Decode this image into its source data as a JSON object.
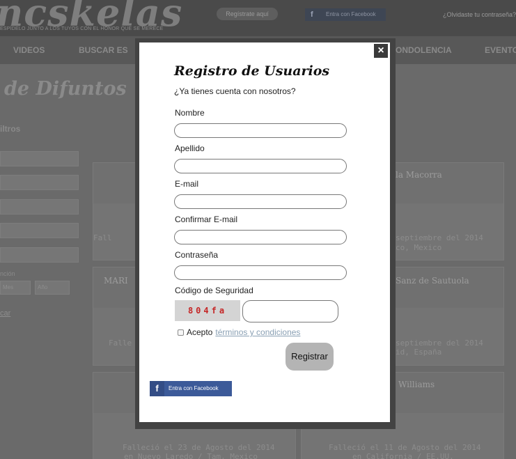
{
  "background": {
    "logo": "ncskelas",
    "tagline": "ESPÍDELO JUNTO A LOS TUYOS CON EL HONOR QUE SE MERECE",
    "register_link": "Regístrate aquí",
    "facebook_login": "Entra con Facebook",
    "forgot_password": "¿Olvidaste tu contraseña?",
    "nav": [
      "VIDEOS",
      "BUSCAR ES",
      "ONDOLENCIA",
      "EVENTO"
    ],
    "page_heading": "de Difuntos",
    "filters_title": "iltros",
    "filter_label": "nción",
    "filter_selects": [
      "Mes",
      "Año"
    ],
    "search_link": "car",
    "cards": [
      {
        "name": "",
        "date_line1": "",
        "date_line2": ""
      },
      {
        "name": "la Macorra",
        "date_line1": "septiembre del 2014",
        "date_line2": "co, Mexico"
      },
      {
        "name": "MARI",
        "date_line1": "Falle",
        "date_line2": ""
      },
      {
        "name": "Sanz de Sautuola",
        "date_line1": "septiembre del 2014",
        "date_line2": "id, España"
      },
      {
        "name": "",
        "date_line1": "Falleció el 23 de Agosto del 2014",
        "date_line2": "en Nuevo Laredo / Tam, Mexico"
      },
      {
        "name": "Williams",
        "date_line1": "Falleció el 11 de Agosto del 2014",
        "date_line2": "en California / EE.UU."
      }
    ],
    "left_card_text": "Fall"
  },
  "modal": {
    "close_icon": "×",
    "title": "Registro de Usuarios",
    "subtitle": "¿Ya tienes cuenta con nosotros?",
    "fields": {
      "nombre": {
        "label": "Nombre",
        "value": ""
      },
      "apellido": {
        "label": "Apellido",
        "value": ""
      },
      "email": {
        "label": "E-mail",
        "value": ""
      },
      "confirm_email": {
        "label": "Confirmar E-mail",
        "value": ""
      },
      "password": {
        "label": "Contraseña",
        "value": ""
      }
    },
    "security_code_label": "Código de Seguridad",
    "captcha_text": "804fa",
    "captcha_value": "",
    "terms_prefix": "Acepto",
    "terms_link": "términos y condiciones",
    "submit_label": "Registrar",
    "facebook_icon": "f",
    "facebook_label": "Entra con Facebook"
  },
  "colors": {
    "overlay": "#6a6a6a",
    "modal_frame": "#434343",
    "facebook_blue": "#3c5a99",
    "captcha_text": "#c52626",
    "terms_link": "#8aa0b4"
  }
}
